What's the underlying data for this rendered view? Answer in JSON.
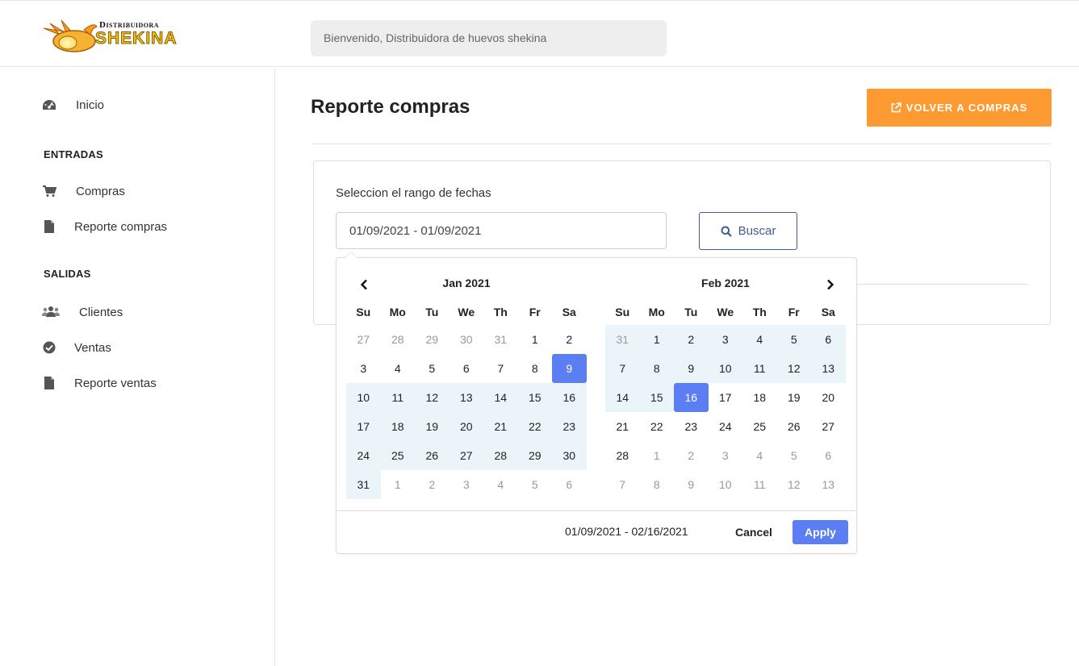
{
  "header": {
    "logo_top": "Distribuidora",
    "logo_main": "SHEKINA",
    "welcome": "Bienvenido, Distribuidora de huevos shekina"
  },
  "sidebar": {
    "home": {
      "label": "Inicio",
      "icon": "dashboard-icon"
    },
    "sections": [
      {
        "heading": "ENTRADAS",
        "items": [
          {
            "label": "Compras",
            "icon": "cart-icon"
          },
          {
            "label": "Reporte compras",
            "icon": "file-icon"
          }
        ]
      },
      {
        "heading": "SALIDAS",
        "items": [
          {
            "label": "Clientes",
            "icon": "users-icon"
          },
          {
            "label": "Ventas",
            "icon": "check-circle-icon"
          },
          {
            "label": "Reporte ventas",
            "icon": "file-icon"
          }
        ]
      }
    ]
  },
  "main": {
    "title": "Reporte compras",
    "back_button": "VOLVER A COMPRAS",
    "range_label": "Seleccion el rango de fechas",
    "range_value": "01/09/2021 - 01/09/2021",
    "search_button": "Buscar"
  },
  "picker": {
    "weekdays": [
      "Su",
      "Mo",
      "Tu",
      "We",
      "Th",
      "Fr",
      "Sa"
    ],
    "calendars": [
      {
        "title": "Jan 2021",
        "weeks": [
          [
            {
              "d": "27",
              "s": "off"
            },
            {
              "d": "28",
              "s": "off"
            },
            {
              "d": "29",
              "s": "off"
            },
            {
              "d": "30",
              "s": "off"
            },
            {
              "d": "31",
              "s": "off"
            },
            {
              "d": "1",
              "s": ""
            },
            {
              "d": "2",
              "s": ""
            }
          ],
          [
            {
              "d": "3",
              "s": ""
            },
            {
              "d": "4",
              "s": ""
            },
            {
              "d": "5",
              "s": ""
            },
            {
              "d": "6",
              "s": ""
            },
            {
              "d": "7",
              "s": ""
            },
            {
              "d": "8",
              "s": ""
            },
            {
              "d": "9",
              "s": "sel"
            }
          ],
          [
            {
              "d": "10",
              "s": "in"
            },
            {
              "d": "11",
              "s": "in"
            },
            {
              "d": "12",
              "s": "in"
            },
            {
              "d": "13",
              "s": "in"
            },
            {
              "d": "14",
              "s": "in"
            },
            {
              "d": "15",
              "s": "in"
            },
            {
              "d": "16",
              "s": "in"
            }
          ],
          [
            {
              "d": "17",
              "s": "in"
            },
            {
              "d": "18",
              "s": "in"
            },
            {
              "d": "19",
              "s": "in"
            },
            {
              "d": "20",
              "s": "in"
            },
            {
              "d": "21",
              "s": "in"
            },
            {
              "d": "22",
              "s": "in"
            },
            {
              "d": "23",
              "s": "in"
            }
          ],
          [
            {
              "d": "24",
              "s": "in"
            },
            {
              "d": "25",
              "s": "in"
            },
            {
              "d": "26",
              "s": "in"
            },
            {
              "d": "27",
              "s": "in"
            },
            {
              "d": "28",
              "s": "in"
            },
            {
              "d": "29",
              "s": "in"
            },
            {
              "d": "30",
              "s": "in"
            }
          ],
          [
            {
              "d": "31",
              "s": "in"
            },
            {
              "d": "1",
              "s": "off"
            },
            {
              "d": "2",
              "s": "off"
            },
            {
              "d": "3",
              "s": "off"
            },
            {
              "d": "4",
              "s": "off"
            },
            {
              "d": "5",
              "s": "off"
            },
            {
              "d": "6",
              "s": "off"
            }
          ]
        ]
      },
      {
        "title": "Feb 2021",
        "weeks": [
          [
            {
              "d": "31",
              "s": "off in"
            },
            {
              "d": "1",
              "s": "in"
            },
            {
              "d": "2",
              "s": "in"
            },
            {
              "d": "3",
              "s": "in"
            },
            {
              "d": "4",
              "s": "in"
            },
            {
              "d": "5",
              "s": "in"
            },
            {
              "d": "6",
              "s": "in"
            }
          ],
          [
            {
              "d": "7",
              "s": "in"
            },
            {
              "d": "8",
              "s": "in"
            },
            {
              "d": "9",
              "s": "in"
            },
            {
              "d": "10",
              "s": "in"
            },
            {
              "d": "11",
              "s": "in"
            },
            {
              "d": "12",
              "s": "in"
            },
            {
              "d": "13",
              "s": "in"
            }
          ],
          [
            {
              "d": "14",
              "s": "in"
            },
            {
              "d": "15",
              "s": "in"
            },
            {
              "d": "16",
              "s": "sel"
            },
            {
              "d": "17",
              "s": ""
            },
            {
              "d": "18",
              "s": ""
            },
            {
              "d": "19",
              "s": ""
            },
            {
              "d": "20",
              "s": ""
            }
          ],
          [
            {
              "d": "21",
              "s": ""
            },
            {
              "d": "22",
              "s": ""
            },
            {
              "d": "23",
              "s": ""
            },
            {
              "d": "24",
              "s": ""
            },
            {
              "d": "25",
              "s": ""
            },
            {
              "d": "26",
              "s": ""
            },
            {
              "d": "27",
              "s": ""
            }
          ],
          [
            {
              "d": "28",
              "s": ""
            },
            {
              "d": "1",
              "s": "off"
            },
            {
              "d": "2",
              "s": "off"
            },
            {
              "d": "3",
              "s": "off"
            },
            {
              "d": "4",
              "s": "off"
            },
            {
              "d": "5",
              "s": "off"
            },
            {
              "d": "6",
              "s": "off"
            }
          ],
          [
            {
              "d": "7",
              "s": "off"
            },
            {
              "d": "8",
              "s": "off"
            },
            {
              "d": "9",
              "s": "off"
            },
            {
              "d": "10",
              "s": "off"
            },
            {
              "d": "11",
              "s": "off"
            },
            {
              "d": "12",
              "s": "off"
            },
            {
              "d": "13",
              "s": "off"
            }
          ]
        ]
      }
    ],
    "selected_range": "01/09/2021 - 02/16/2021",
    "cancel": "Cancel",
    "apply": "Apply"
  },
  "colors": {
    "accent_orange": "#fd9b32",
    "primary_blue": "#5b7ef2",
    "range_bg": "#ebf4f8",
    "search_border": "#3f5b8f"
  }
}
